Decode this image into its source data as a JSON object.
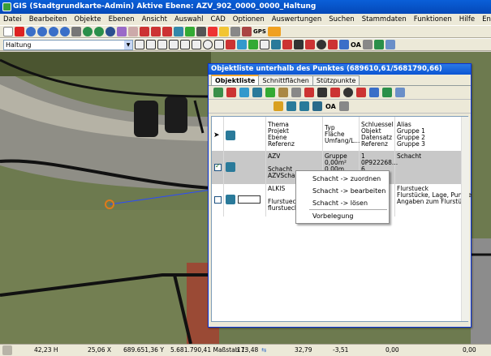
{
  "window": {
    "title": "GIS (Stadtgrundkarte-Admin) Aktive Ebene: AZV_902_0000_0000_Haltung"
  },
  "menu": [
    "Datei",
    "Bearbeiten",
    "Objekte",
    "Ebenen",
    "Ansicht",
    "Auswahl",
    "CAD",
    "Optionen",
    "Auswertungen",
    "Suchen",
    "Stammdaten",
    "Funktionen",
    "Hilfe",
    "Entw."
  ],
  "layer_combo": {
    "value": "Haltung"
  },
  "toolbar": {
    "gps_label": "GPS",
    "oa_label": "OA"
  },
  "panel": {
    "title": "Objektliste unterhalb des Punktes (689610,61/5681790,66)",
    "tabs": [
      "Objektliste",
      "Schnittflächen",
      "Stützpunkte"
    ],
    "oa_label": "OA",
    "columns": {
      "thema": [
        "Thema",
        "Projekt",
        "Ebene",
        "Referenz"
      ],
      "typ": [
        "Typ",
        "Fläche",
        "Umfang/L..."
      ],
      "schluessel": [
        "Schluessel",
        "Objekt",
        "Datensatz",
        "Referenz"
      ],
      "alias": [
        "Alias",
        "Gruppe 1",
        "Gruppe 2",
        "Gruppe 3"
      ]
    },
    "rows": [
      {
        "checked": true,
        "thema": [
          "AZV",
          "",
          "Schacht",
          "AZVSchacht"
        ],
        "typ": [
          "Gruppe",
          "0,00m²",
          "0,00m"
        ],
        "schluessel": [
          "1",
          "0P922268...",
          "6"
        ],
        "alias": [
          "Schacht"
        ]
      },
      {
        "checked": false,
        "thema": [
          "ALKIS",
          "",
          "Flurstueck",
          "flurstueck"
        ],
        "typ": [],
        "schluessel": [],
        "alias": [
          "Flurstueck",
          "Flurstücke, Lage, Punkte",
          "Angaben zum Flurstück"
        ]
      }
    ]
  },
  "context_menu": [
    "Schacht -> zuordnen",
    "Schacht -> bearbeiten",
    "Schacht -> lösen",
    "Vorbelegung"
  ],
  "status": {
    "s1": "42,23 H",
    "s2": "25,06 X",
    "s3": "689.651,36 Y",
    "s4": "5.681.790,41 Maßstab 1:",
    "s5": "173,48",
    "s6": "32,79",
    "s7": "-3,51",
    "s8": "0,00",
    "s9": "0,00"
  },
  "colors": {
    "title_blue": "#0a5fd8",
    "selected_row": "#c8c8c8",
    "map_road": "#8f8e86"
  }
}
